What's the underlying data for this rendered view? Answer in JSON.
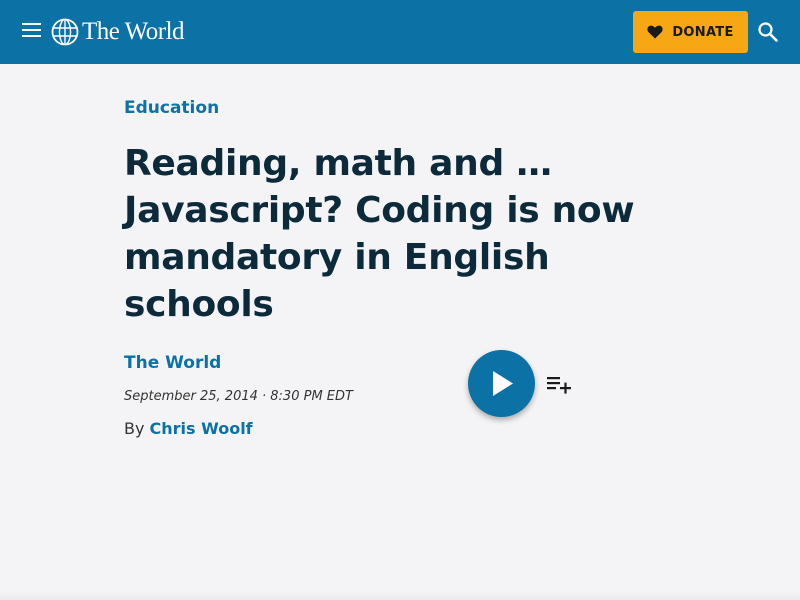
{
  "header": {
    "brand": "The World",
    "donate_label": "DONATE",
    "colors": {
      "header_bg": "#0c72a6",
      "donate_bg": "#f7a713"
    },
    "icons": [
      "menu-icon",
      "globe-icon",
      "heart-icon",
      "search-icon"
    ]
  },
  "article": {
    "category": "Education",
    "title": "Reading, math and … Javascript? Coding is now mandatory in English schools",
    "program": "The World",
    "dateline": "September 25, 2014 · 8:30 PM EDT",
    "byline_prefix": "By ",
    "author": "Chris Woolf"
  },
  "audio": {
    "icons": [
      "play-icon",
      "playlist-add-icon"
    ]
  }
}
